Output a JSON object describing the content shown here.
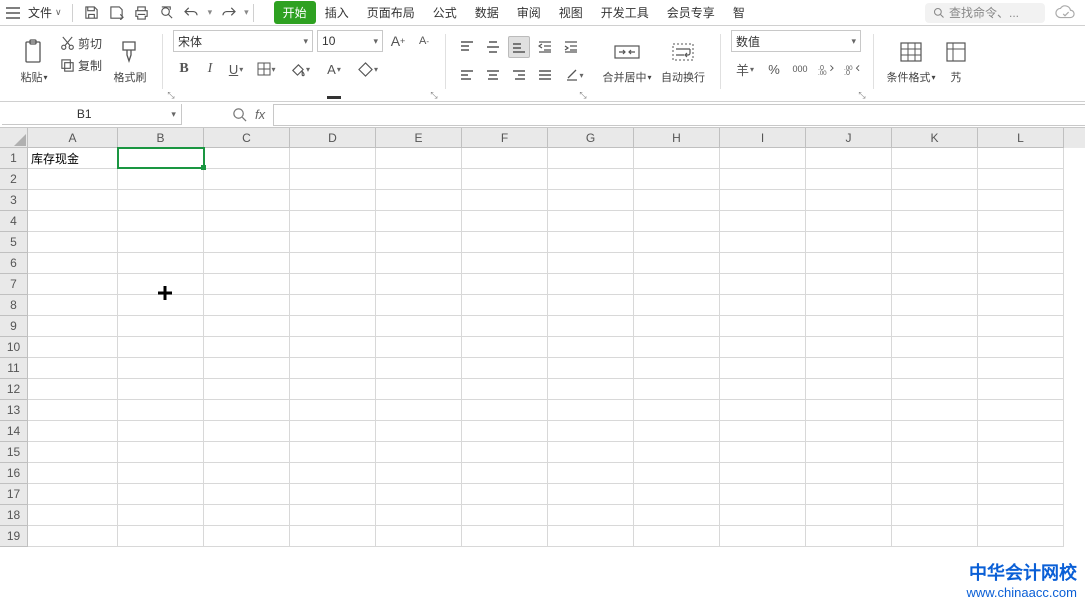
{
  "menubar": {
    "file_label": "文件",
    "search_placeholder": "查找命令、..."
  },
  "tabs": {
    "items": [
      "开始",
      "插入",
      "页面布局",
      "公式",
      "数据",
      "审阅",
      "视图",
      "开发工具",
      "会员专享",
      "智"
    ],
    "active_index": 0
  },
  "ribbon": {
    "clipboard": {
      "paste": "粘贴",
      "cut": "剪切",
      "copy": "复制",
      "format_painter": "格式刷"
    },
    "font": {
      "name": "宋体",
      "size": "10"
    },
    "alignment": {
      "merge_center": "合并居中",
      "wrap_text": "自动换行"
    },
    "number": {
      "format": "数值"
    },
    "styles": {
      "cond_format": "条件格式"
    }
  },
  "namebox": {
    "value": "B1"
  },
  "formula": {
    "value": ""
  },
  "grid": {
    "columns": [
      "A",
      "B",
      "C",
      "D",
      "E",
      "F",
      "G",
      "H",
      "I",
      "J",
      "K",
      "L"
    ],
    "rows": [
      "1",
      "2",
      "3",
      "4",
      "5",
      "6",
      "7",
      "8",
      "9",
      "10",
      "11",
      "12",
      "13",
      "14",
      "15",
      "16",
      "17",
      "18",
      "19"
    ],
    "cells": {
      "A1": "库存现金"
    },
    "active": "B1"
  },
  "watermark": {
    "line1": "中华会计网校",
    "line2": "www.chinaacc.com"
  }
}
